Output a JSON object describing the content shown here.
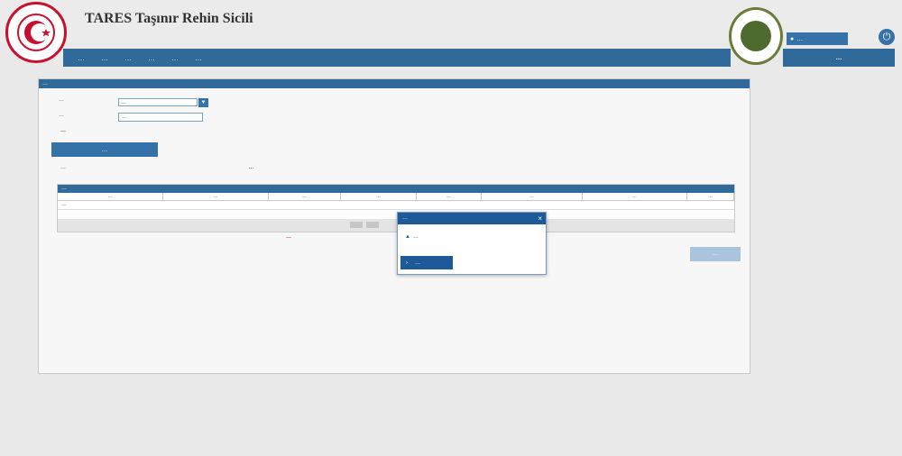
{
  "app": {
    "title": "TARES Taşınır Rehin Sicili"
  },
  "nav": {
    "items": [
      "…",
      "…",
      "…",
      "…",
      "…",
      "…"
    ]
  },
  "user": {
    "name_label": "…",
    "logout_label": "…"
  },
  "panel": {
    "header": "…",
    "field1_label": "…",
    "field1_value": "…",
    "field2_label": "…",
    "field2_value": "…",
    "warning": "…",
    "query_button": "…",
    "date_label": "…",
    "date_value": "…",
    "grid_title": "…",
    "grid_columns": [
      "…",
      "…",
      "…",
      "…",
      "…",
      "…",
      "…",
      "…"
    ],
    "grid_empty": "…",
    "note": "…",
    "action_button": "…"
  },
  "modal": {
    "title": "…",
    "message": "…",
    "ok_label": "…"
  }
}
